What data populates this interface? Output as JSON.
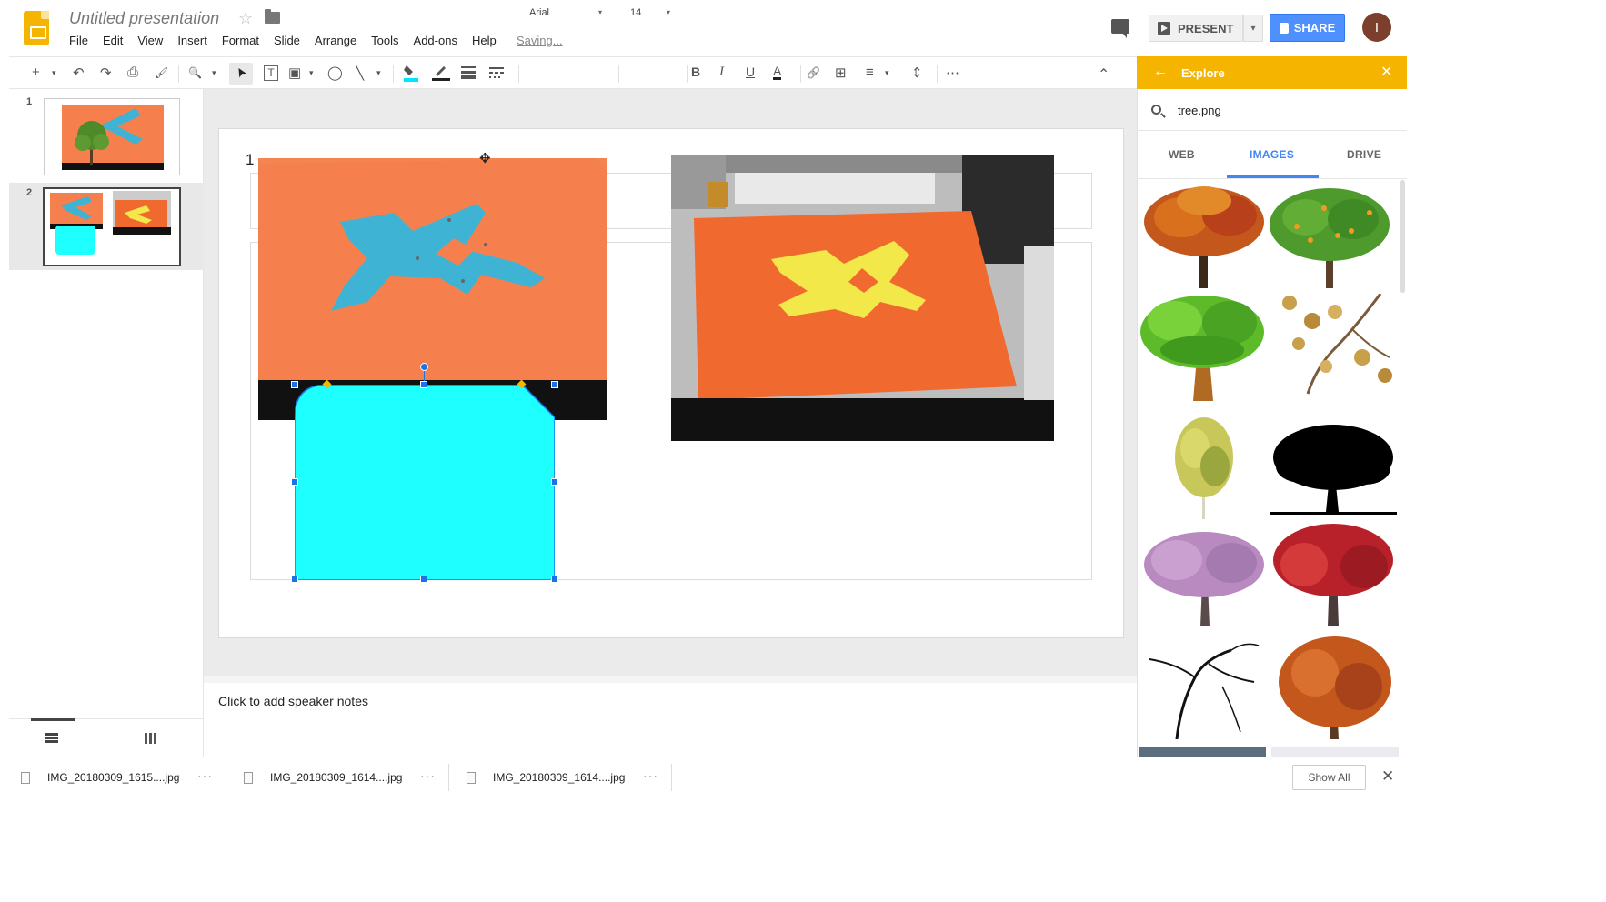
{
  "header": {
    "doc_title": "Untitled presentation",
    "star_glyph": "☆",
    "saving_status": "Saving...",
    "menu": [
      "File",
      "Edit",
      "View",
      "Insert",
      "Format",
      "Slide",
      "Arrange",
      "Tools",
      "Add-ons",
      "Help"
    ],
    "present_label": "PRESENT",
    "share_label": "SHARE",
    "avatar_initial": "I",
    "dropdown_glyph": "▾"
  },
  "toolbar": {
    "font": "Arial",
    "font_size": "14",
    "glyphs": {
      "new_slide": "+",
      "undo": "↶",
      "redo": "↷",
      "print": "⎙",
      "paint_format": "🖌",
      "zoom": "🔍",
      "select": "➤",
      "text_box": "T",
      "image": "▣",
      "shape": "◯",
      "line": "╲",
      "bold": "B",
      "italic": "I",
      "underline": "U",
      "text_color": "A",
      "link": "🔗",
      "comment": "⊞",
      "align": "≡",
      "line_spacing": "⇕",
      "more": "⋯",
      "collapse": "⌃"
    }
  },
  "filmstrip": {
    "slides": [
      {
        "number": "1"
      },
      {
        "number": "2"
      }
    ]
  },
  "slide": {
    "number_text": "1",
    "move_cursor_glyph": "✥"
  },
  "notes": {
    "placeholder": "Click to add speaker notes"
  },
  "explore": {
    "title": "Explore",
    "back_glyph": "←",
    "close_glyph": "✕",
    "search_query": "tree.png",
    "tabs": [
      "WEB",
      "IMAGES",
      "DRIVE"
    ],
    "active_tab": "IMAGES"
  },
  "downloads": {
    "items": [
      "IMG_20180309_1615....jpg",
      "IMG_20180309_1614....jpg",
      "IMG_20180309_1614....jpg"
    ],
    "menu_glyph": "···",
    "show_all": "Show All",
    "close_glyph": "✕"
  },
  "colors": {
    "accent_yellow": "#f4b400",
    "share_blue": "#4d90fe",
    "shape_fill": "#1effff",
    "selection_blue": "#1a73e8",
    "photo_orange": "#f5804d"
  }
}
